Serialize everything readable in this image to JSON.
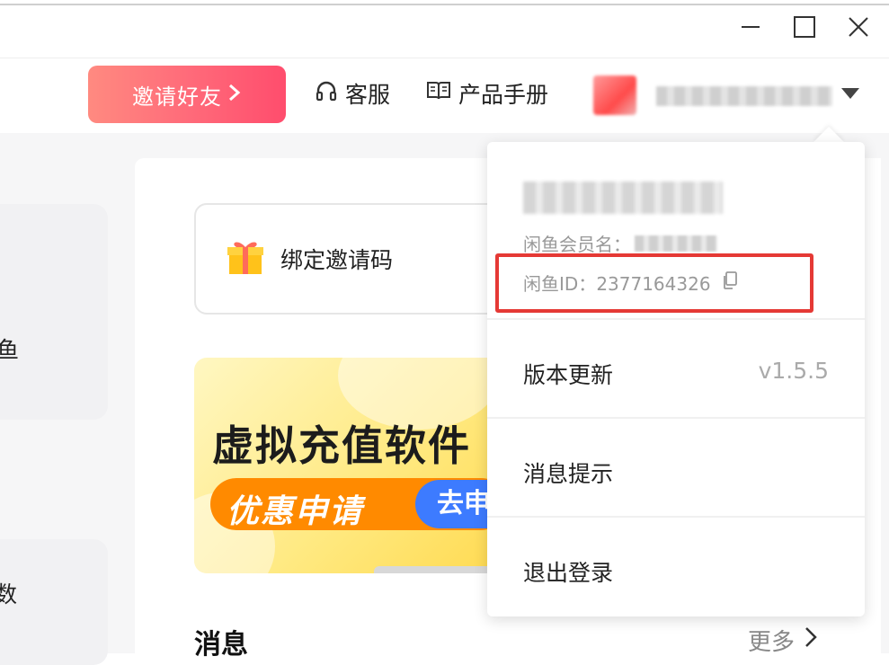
{
  "window": {
    "minimize_icon": "minimize-icon",
    "maximize_icon": "maximize-icon",
    "close_icon": "close-icon"
  },
  "topbar": {
    "invite_label": "邀请好友",
    "service_label": "客服",
    "service_icon": "headset-icon",
    "manual_label": "产品手册",
    "manual_icon": "book-icon",
    "user_caret_icon": "caret-down-icon"
  },
  "left_panel": {
    "fragment_1": "鱼",
    "fragment_2": "数"
  },
  "main": {
    "bind_label": "绑定邀请码",
    "bind_icon": "gift-icon",
    "banner": {
      "title": "虚拟充值软件",
      "pill_text": "优惠申请",
      "go_label": "去申"
    },
    "messages_title": "消息",
    "more_label": "更多"
  },
  "dropdown": {
    "member_label": "闲鱼会员名：",
    "id_label": "闲鱼ID：",
    "id_value": "2377164326",
    "copy_icon": "copy-icon",
    "items": [
      {
        "label": "版本更新",
        "value": "v1.5.5"
      },
      {
        "label": "消息提示"
      },
      {
        "label": "退出登录"
      }
    ]
  },
  "colors": {
    "invite_gradient_start": "#ff8a80",
    "invite_gradient_end": "#ff4d6d",
    "highlight": "#e53935",
    "banner_yellow": "#ffe980",
    "pill_orange": "#ff8a00",
    "go_blue": "#3d7bff"
  }
}
